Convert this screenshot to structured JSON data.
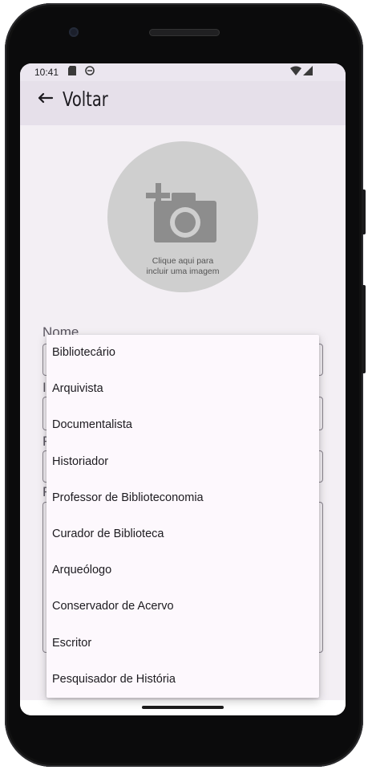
{
  "status_bar": {
    "time": "10:41",
    "icons": [
      "sd-card-icon",
      "sync-icon",
      "wifi-icon",
      "signal-icon"
    ]
  },
  "header": {
    "back_arrow": "↩",
    "back_label": "Voltar"
  },
  "photo_picker": {
    "icon": "add-camera-icon",
    "text_line1": "Clique aqui para",
    "text_line2": "incluir uma imagem"
  },
  "form": {
    "name_label": "Nome",
    "partial_label_2": "I",
    "partial_label_3": "F",
    "partial_label_4": "F"
  },
  "dropdown": {
    "options": [
      "Bibliotecário",
      "Arquivista",
      "Documentalista",
      "Historiador",
      "Professor de Biblioteconomia",
      "Curador de Biblioteca",
      "Arqueólogo",
      "Conservador de Acervo",
      "Escritor",
      "Pesquisador de História"
    ]
  },
  "colors": {
    "screen_bg": "#f3eff4",
    "topbar_bg": "#e6e0ea",
    "menu_bg": "#fdf8fd",
    "photo_circle": "#cfcfcf"
  }
}
